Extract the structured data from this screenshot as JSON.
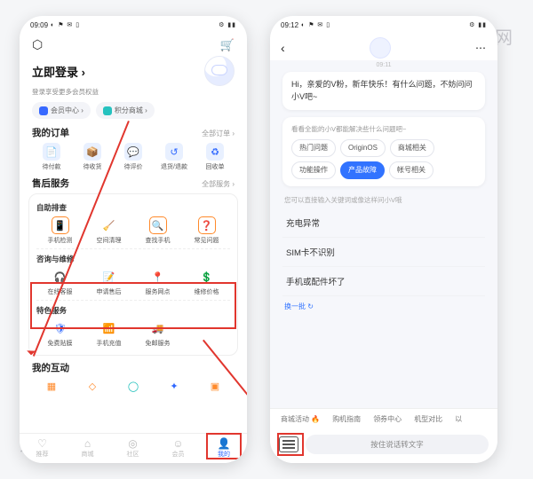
{
  "watermark": "爱创根知识网",
  "left": {
    "status_time": "09:09",
    "login_title": "立即登录 ›",
    "login_sub": "登录享受更多会员权益",
    "chip_member": "会员中心 ›",
    "chip_points": "积分商城 ›",
    "orders": {
      "title": "我的订单",
      "more": "全部订单 ›",
      "items": [
        {
          "icon": "📄",
          "label": "待付款"
        },
        {
          "icon": "📦",
          "label": "待收货"
        },
        {
          "icon": "💬",
          "label": "待评价"
        },
        {
          "icon": "↺",
          "label": "退货/退款"
        },
        {
          "icon": "♻",
          "label": "回收单"
        }
      ]
    },
    "after": {
      "title": "售后服务",
      "more": "全部服务 ›",
      "g1_label": "自助排查",
      "g1": [
        {
          "icon": "📱",
          "label": "手机检测"
        },
        {
          "icon": "🧹",
          "label": "空间清理"
        },
        {
          "icon": "🔍",
          "label": "查找手机"
        },
        {
          "icon": "❓",
          "label": "常见问题"
        }
      ],
      "g2_label": "咨询与维修",
      "g2": [
        {
          "icon": "🎧",
          "label": "在线客服"
        },
        {
          "icon": "📝",
          "label": "申请售后"
        },
        {
          "icon": "📍",
          "label": "服务网点"
        },
        {
          "icon": "💲",
          "label": "维修价格"
        }
      ],
      "g3_label": "特色服务",
      "g3": [
        {
          "icon": "🛡",
          "label": "免费贴膜"
        },
        {
          "icon": "📶",
          "label": "手机充值"
        },
        {
          "icon": "🚚",
          "label": "免邮服务"
        }
      ]
    },
    "inter_title": "我的互动",
    "tabs": [
      {
        "icon": "♡",
        "label": "推荐"
      },
      {
        "icon": "⌂",
        "label": "商城"
      },
      {
        "icon": "◎",
        "label": "社区"
      },
      {
        "icon": "☺",
        "label": "会员"
      },
      {
        "icon": "👤",
        "label": "我的"
      }
    ]
  },
  "right": {
    "status_time": "09:12",
    "msg_time": "09:11",
    "greeting": "Hi，亲爱的V粉，新年快乐！有什么问题，不妨问问小V吧~",
    "panel_hint": "看看全能的小V都能解决些什么问题吧~",
    "cats": [
      "热门问题",
      "OriginOS",
      "商城相关",
      "功能操作",
      "产品故障",
      "帐号相关"
    ],
    "active_cat": "产品故障",
    "suggest_hint": "您可以直接输入关键词或像这样问小V哦",
    "suggestions": [
      "充电异常",
      "SIM卡不识别",
      "手机或配件坏了"
    ],
    "refresh": "换一批 ↻",
    "quicklinks": [
      "商城活动 🔥",
      "购机指南",
      "领券中心",
      "机型对比",
      "以"
    ],
    "voice_placeholder": "按住说话转文字"
  }
}
